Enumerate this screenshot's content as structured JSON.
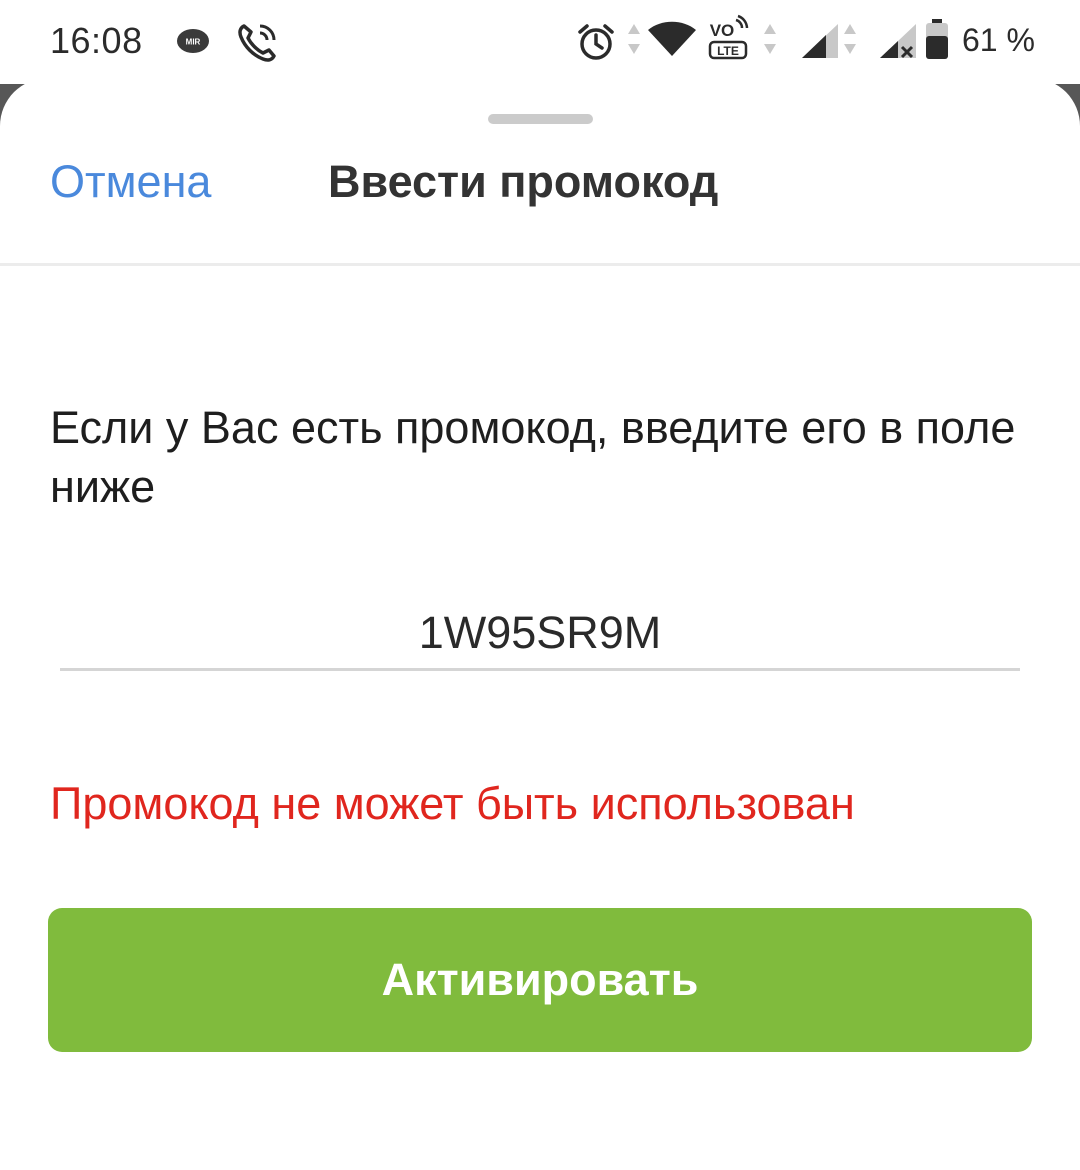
{
  "status_bar": {
    "time": "16:08",
    "battery_percent": "61 %",
    "icons": [
      "mir-icon",
      "phone-call-icon",
      "alarm-icon",
      "wifi-icon",
      "volte-icon",
      "signal-icon",
      "signal-no-service-icon",
      "battery-icon"
    ]
  },
  "sheet": {
    "cancel_label": "Отмена",
    "title": "Ввести промокод",
    "description": "Если у Вас есть промокод, введите его в поле ниже",
    "promo_value": "1W95SR9M",
    "error_message": "Промокод не может быть использован",
    "activate_label": "Активировать"
  },
  "colors": {
    "link": "#4a89dc",
    "error": "#e0261e",
    "button": "#80bb3d",
    "backdrop": "#575757"
  }
}
